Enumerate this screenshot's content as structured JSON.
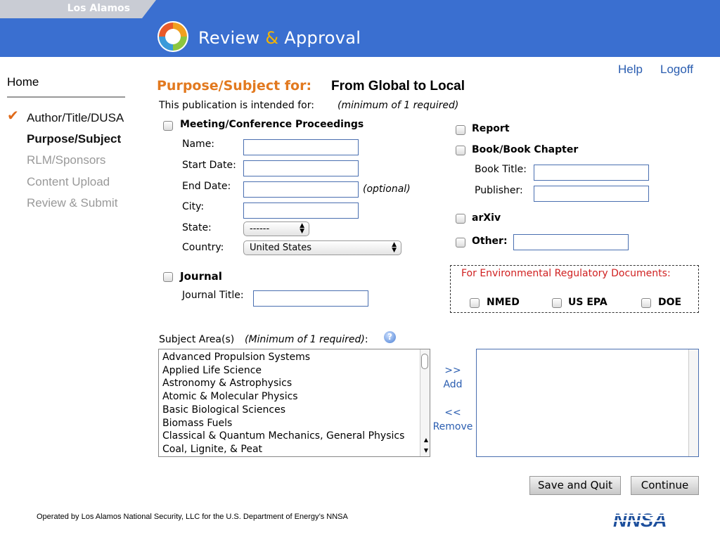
{
  "header": {
    "org_name": "Los Alamos",
    "app_title_part1": "Review ",
    "app_title_amp": "&",
    "app_title_part2": " Approval"
  },
  "top_links": {
    "help": "Help",
    "logoff": "Logoff"
  },
  "nav": {
    "home": "Home",
    "items": [
      {
        "label": "Author/Title/DUSA",
        "state": "done"
      },
      {
        "label": "Purpose/Subject",
        "state": "current"
      },
      {
        "label": "RLM/Sponsors",
        "state": "future"
      },
      {
        "label": "Content Upload",
        "state": "future"
      },
      {
        "label": "Review & Submit",
        "state": "future"
      }
    ]
  },
  "main": {
    "heading": "Purpose/Subject for:",
    "publication_title": "From Global to Local",
    "intended_text": "This publication is intended for:",
    "intended_note": "(minimum of 1 required)"
  },
  "meeting": {
    "label": "Meeting/Conference Proceedings",
    "name_label": "Name:",
    "start_label": "Start Date:",
    "end_label": "End Date:",
    "optional": "(optional)",
    "city_label": "City:",
    "state_label": "State:",
    "state_value": "------",
    "country_label": "Country:",
    "country_value": "United States"
  },
  "journal": {
    "label": "Journal",
    "title_label": "Journal Title:"
  },
  "right_options": {
    "report": "Report",
    "book": "Book/Book Chapter",
    "book_title_label": "Book Title:",
    "publisher_label": "Publisher:",
    "arxiv": "arXiv",
    "other": "Other:"
  },
  "env": {
    "title": "For Environmental Regulatory Documents:",
    "nmed": "NMED",
    "usepa": "US EPA",
    "doe": "DOE"
  },
  "subject": {
    "label": "Subject Area(s)",
    "note": "(Minimum of 1 required)",
    "colon": ":",
    "options": [
      "Advanced Propulsion Systems",
      "Applied Life Science",
      "Astronomy & Astrophysics",
      "Atomic & Molecular Physics",
      "Basic Biological Sciences",
      "Biomass Fuels",
      "Classical & Quantum Mechanics, General Physics",
      "Coal, Lignite, & Peat"
    ],
    "add_arrows": ">>",
    "add_label": "Add",
    "remove_arrows": "<<",
    "remove_label": "Remove"
  },
  "buttons": {
    "save_quit": "Save and Quit",
    "continue": "Continue"
  },
  "footer": {
    "text": "Operated by Los Alamos National Security, LLC for the U.S. Department of Energy’s NNSA",
    "logo_text": "NNSA"
  },
  "colors": {
    "header_blue": "#3a6fd0",
    "heading_orange": "#e2791f",
    "link_blue": "#2a5db0",
    "env_red": "#d02020"
  }
}
